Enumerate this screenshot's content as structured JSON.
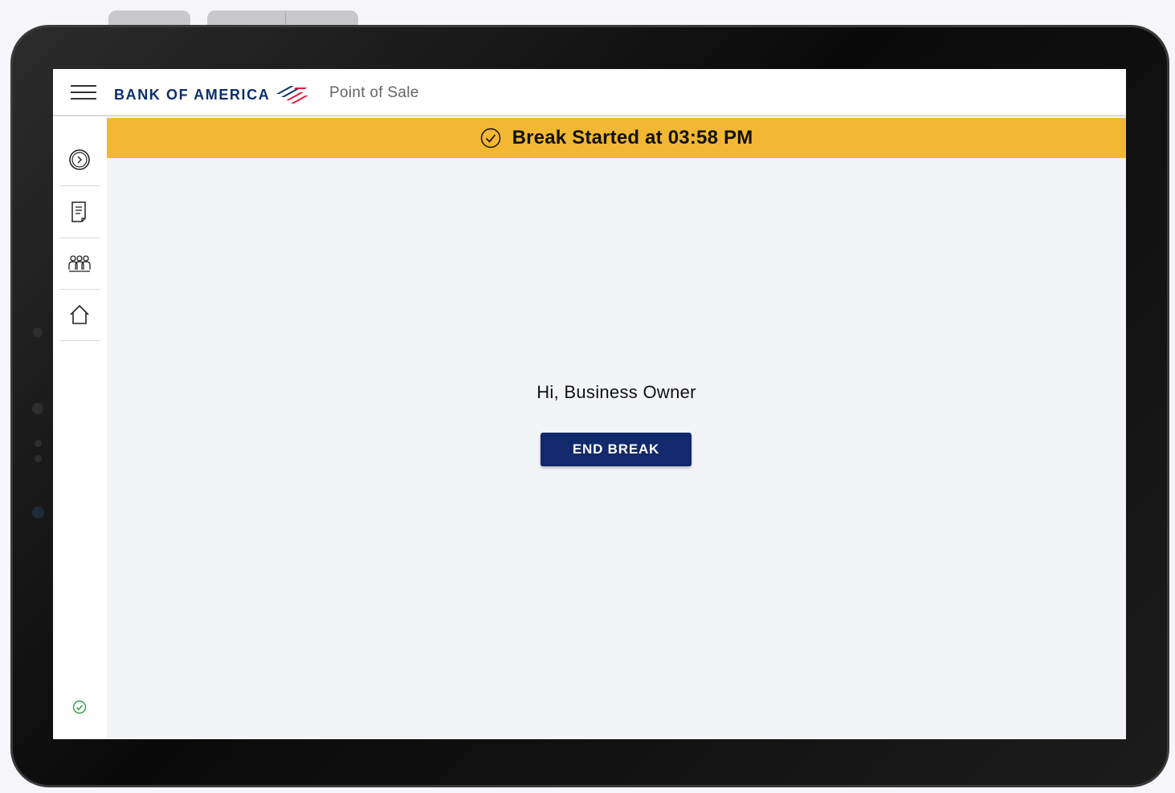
{
  "header": {
    "brand": "BANK OF AMERICA",
    "app_title": "Point of Sale"
  },
  "sidebar": {
    "items": [
      {
        "name": "clock-icon"
      },
      {
        "name": "receipt-icon"
      },
      {
        "name": "team-icon"
      },
      {
        "name": "home-icon"
      }
    ],
    "status_icon": "check-circle-icon"
  },
  "banner": {
    "text": "Break Started at 03:58 PM",
    "icon": "check-circle-icon",
    "color": "#f2b833"
  },
  "main": {
    "greeting": "Hi, Business Owner",
    "end_break_label": "END BREAK"
  },
  "colors": {
    "brand_blue": "#0a2d6e",
    "brand_red": "#e31837",
    "button_bg": "#12296b",
    "status_ok": "#2e9e44"
  }
}
